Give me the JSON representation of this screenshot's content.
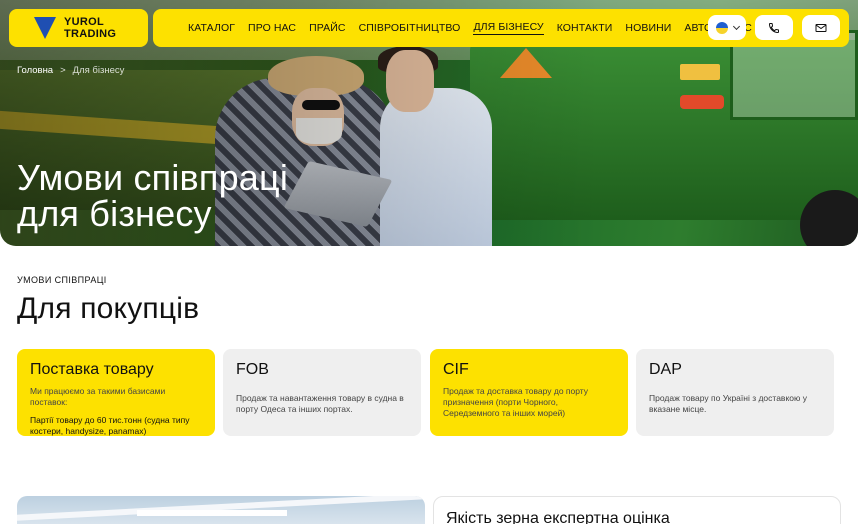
{
  "logo": {
    "line1": "YUROL",
    "line2": "TRADING"
  },
  "nav": {
    "items": [
      {
        "label": "КАТАЛОГ",
        "active": false
      },
      {
        "label": "ПРО НАС",
        "active": false
      },
      {
        "label": "ПРАЙС",
        "active": false
      },
      {
        "label": "СПІВРОБІТНИЦТВО",
        "active": false
      },
      {
        "label": "ДЛЯ БІЗНЕСУ",
        "active": true
      },
      {
        "label": "КОНТАКТИ",
        "active": false
      },
      {
        "label": "НОВИНИ",
        "active": false
      },
      {
        "label": "АВТОСЕРВІС",
        "active": false
      }
    ],
    "language_icon": "ukraine-flag-icon",
    "phone_icon": "phone-icon",
    "mail_icon": "mail-icon"
  },
  "breadcrumb": {
    "home": "Головна",
    "separator": ">",
    "current": "Для бізнесу"
  },
  "hero": {
    "title_line1": "Умови співпраці",
    "title_line2": "для бізнесу"
  },
  "section": {
    "eyebrow": "УМОВИ СПІВПРАЦІ",
    "title": "Для покупців",
    "cards": [
      {
        "title": "Поставка товару",
        "text": "Ми працюємо за такими базисами поставок:",
        "strong": "Партії товару до 60 тис.тонн (судна типу костери, handysize, panamax)",
        "style": "yellow"
      },
      {
        "title": "FOB",
        "text": "Продаж та навантаження товару в судна в порту Одеса та інших портах.",
        "style": "grey"
      },
      {
        "title": "CIF",
        "text": "Продаж та доставка товару до порту призначення (порти Чорного, Середземного та інших морей)",
        "style": "yellow"
      },
      {
        "title": "DAP",
        "text": "Продаж товару по Україні з доставкою у вказане місце.",
        "style": "grey"
      }
    ]
  },
  "bottom": {
    "quality_title": "Якість зерна експертна оцінка"
  },
  "colors": {
    "accent": "#fde100",
    "card_grey": "#efefef",
    "logo_blue": "#1f4fb2"
  }
}
